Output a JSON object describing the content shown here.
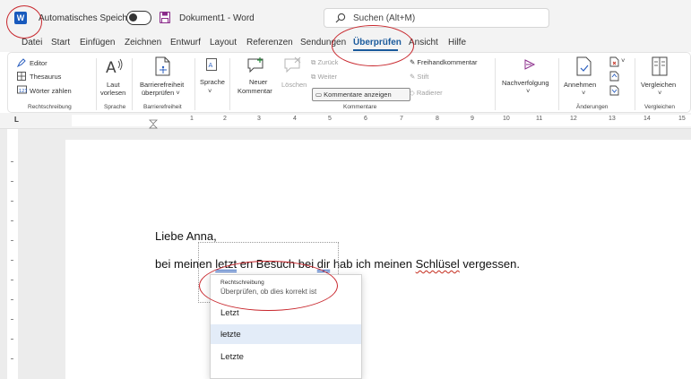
{
  "titlebar": {
    "app_icon_letter": "W",
    "autosave_label": "Automatisches Speichern",
    "document_title": "Dokument1 - Word",
    "search_placeholder": "Suchen (Alt+M)"
  },
  "tabs": [
    "Datei",
    "Start",
    "Einfügen",
    "Zeichnen",
    "Entwurf",
    "Layout",
    "Referenzen",
    "Sendungen",
    "Überprüfen",
    "Ansicht",
    "Hilfe"
  ],
  "active_tab": "Überprüfen",
  "ribbon": {
    "rechtschreibung": {
      "items": [
        "Editor",
        "Thesaurus",
        "Wörter zählen"
      ],
      "label": "Rechtschreibung"
    },
    "sprache_group": {
      "button_line1": "Laut",
      "button_line2": "vorlesen",
      "label": "Sprache"
    },
    "barrierefreiheit": {
      "button_line1": "Barrierefreiheit",
      "button_line2": "überprüfen ˅",
      "label": "Barrierefreiheit"
    },
    "sprache_button": {
      "label": "Sprache",
      "chevron": "˅"
    },
    "kommentare": {
      "neuer_line1": "Neuer",
      "neuer_line2": "Kommentar",
      "loeschen": "Löschen",
      "zurueck": "Zurück",
      "weiter": "Weiter",
      "anzeigen": "Kommentare anzeigen",
      "freihand": "Freihandkommentar",
      "stift": "Stift",
      "radierer": "Radierer",
      "label": "Kommentare"
    },
    "nachverfolgung": {
      "label": "Nachverfolgung",
      "chevron": "˅"
    },
    "aenderungen": {
      "annehmen": "Annehmen",
      "chevron": "˅",
      "label": "Änderungen"
    },
    "vergleichen": {
      "button": "Vergleichen",
      "chevron": "˅",
      "label": "Vergleichen"
    }
  },
  "ruler": {
    "numbers": [
      "1",
      "2",
      "3",
      "4",
      "5",
      "6",
      "7",
      "8",
      "9",
      "10",
      "11",
      "12",
      "13",
      "14",
      "15"
    ]
  },
  "document": {
    "line1": "Liebe Anna,",
    "line2": {
      "w1": "bei",
      "w2": "meinen",
      "w3": "letzt",
      "w4": "en Besuch bei",
      "w5": "dir",
      "w6": "hab ich meinen",
      "w7": "Schlüsel",
      "w8": "vergessen."
    }
  },
  "popup": {
    "heading": "Rechtschreibung",
    "subtitle": "Überprüfen, ob dies korrekt ist",
    "suggestions": [
      "Letzt",
      "letzte",
      "Letzte"
    ],
    "highlighted_index": 1,
    "more": "···"
  },
  "colors": {
    "word_blue": "#185abd",
    "accent": "#1a5a9c",
    "annotation_red": "#c8262c",
    "highlight": "#e3ecf8"
  }
}
